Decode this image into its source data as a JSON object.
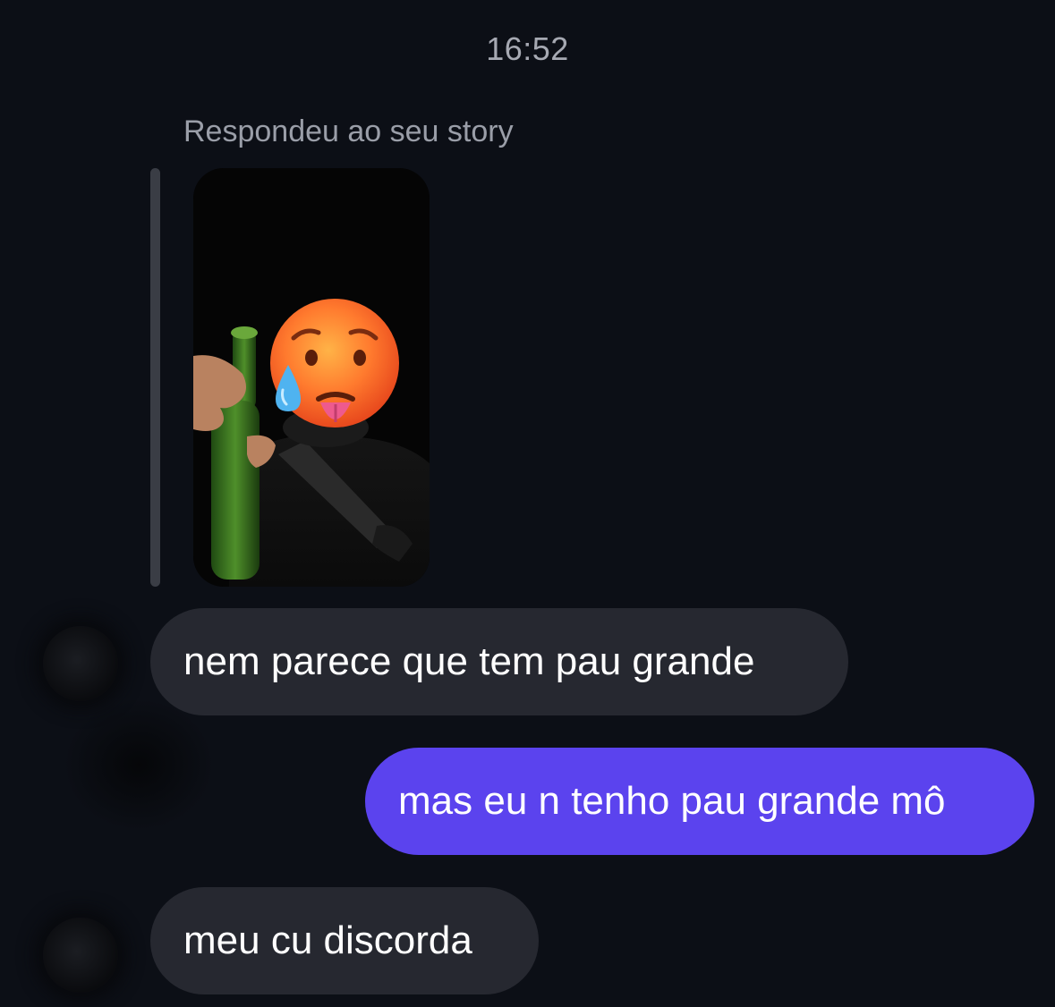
{
  "header": {
    "time": "16:52"
  },
  "story_reply": {
    "label": "Respondeu ao seu story",
    "thumbnail": {
      "icon": "hot-face-emoji-icon"
    }
  },
  "messages": [
    {
      "direction": "incoming",
      "text": "nem parece que tem pau grande"
    },
    {
      "direction": "outgoing",
      "text": "mas eu n tenho pau grande mô"
    },
    {
      "direction": "incoming",
      "text": "meu cu discorda"
    }
  ],
  "colors": {
    "background": "#0c0f16",
    "incoming_bubble": "#262830",
    "outgoing_bubble": "#5b43ee",
    "muted_text": "#a6a9b2"
  }
}
